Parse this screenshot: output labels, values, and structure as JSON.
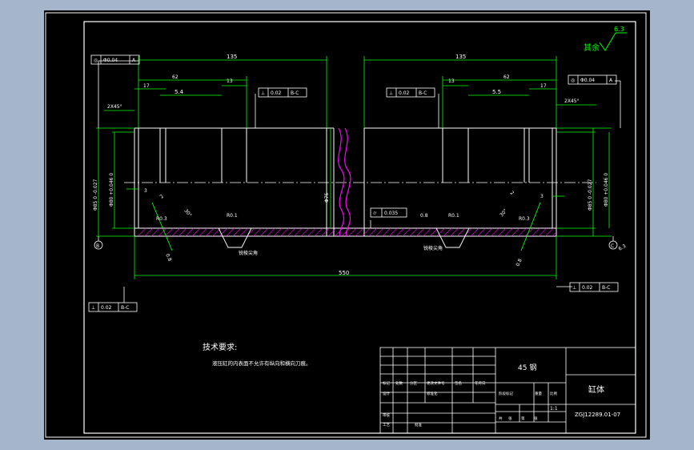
{
  "part_name": "缸体",
  "material": "45 钢",
  "drawing_number": "ZGJ12289.01-07",
  "scale": "1:1",
  "surface_finish": {
    "rest_label": "其余",
    "value": "6.3"
  },
  "tech_requirements": {
    "title": "技术要求:",
    "text": "液压缸的内表面不允许有纵向和横向刀痕。"
  },
  "dimensions": {
    "overall_length": "550",
    "left_segment": "135",
    "right_segment": "135",
    "left_62": "62",
    "right_62": "62",
    "left_17": "17",
    "right_17": "17",
    "left_groove": "5.4",
    "right_groove": "5.5",
    "left_13": "13",
    "right_13": "13",
    "chamfer_left": "2X45°",
    "chamfer_right": "2X45°",
    "step_left": "3",
    "step_right": "3",
    "bore_center": "Φ75",
    "dia_outer_left": "Φ85 0 -0.027",
    "dia_inner_left": "Φ80 +0.046 0",
    "dia_outer_right": "Φ85 0 -0.027",
    "dia_inner_right": "Φ80 +0.046 0"
  },
  "annotations": {
    "radius_1": "R0.3",
    "radius_2": "R0.1",
    "radius_3": "R0.1",
    "radius_4": "R0.3",
    "roughness_1": "0.8",
    "roughness_2": "0.8",
    "roughness_3": "0.8",
    "roughness_4": "0.8",
    "roughness_5": "0.8",
    "angle_left": "30°",
    "angle_right": "30°",
    "dim_2_left": "2",
    "dim_2_right": "2",
    "sharp_edge_left": "锐棱尖角",
    "sharp_edge_right": "锐棱尖角",
    "datum_b": "B",
    "datum_c": "C",
    "roughness_c": "6.3"
  },
  "tolerances": {
    "runout_left": {
      "symbol": "◎",
      "value": "Φ0.04",
      "datum": "A"
    },
    "runout_right": {
      "symbol": "◎",
      "value": "Φ0.04",
      "datum": "A"
    },
    "perp_left_face": {
      "symbol": "⊥",
      "value": "0.02",
      "datum": "B-C"
    },
    "perp_right_face": {
      "symbol": "⊥",
      "value": "0.02",
      "datum": "B-C"
    },
    "perp_bottom_left": {
      "symbol": "⊥",
      "value": "0.02",
      "datum": "B-C"
    },
    "perp_bottom_right": {
      "symbol": "⊥",
      "value": "0.02",
      "datum": "B-C"
    },
    "cylindricity": {
      "symbol": "⌭",
      "value": "0.035"
    }
  },
  "title_block": {
    "row_labels": [
      "标记",
      "处数",
      "分区",
      "更改文件号",
      "签名",
      "年月日"
    ],
    "design_row": [
      "设计",
      "",
      "",
      "标准化",
      "",
      ""
    ],
    "review_row": [
      "审核",
      "",
      "",
      "",
      "",
      ""
    ],
    "process_row": [
      "工艺",
      "",
      "",
      "批准",
      "",
      ""
    ],
    "stage_labels": [
      "阶段标记",
      "重量",
      "比例"
    ],
    "sheet_labels": [
      "共",
      "张",
      "第",
      "张"
    ]
  }
}
